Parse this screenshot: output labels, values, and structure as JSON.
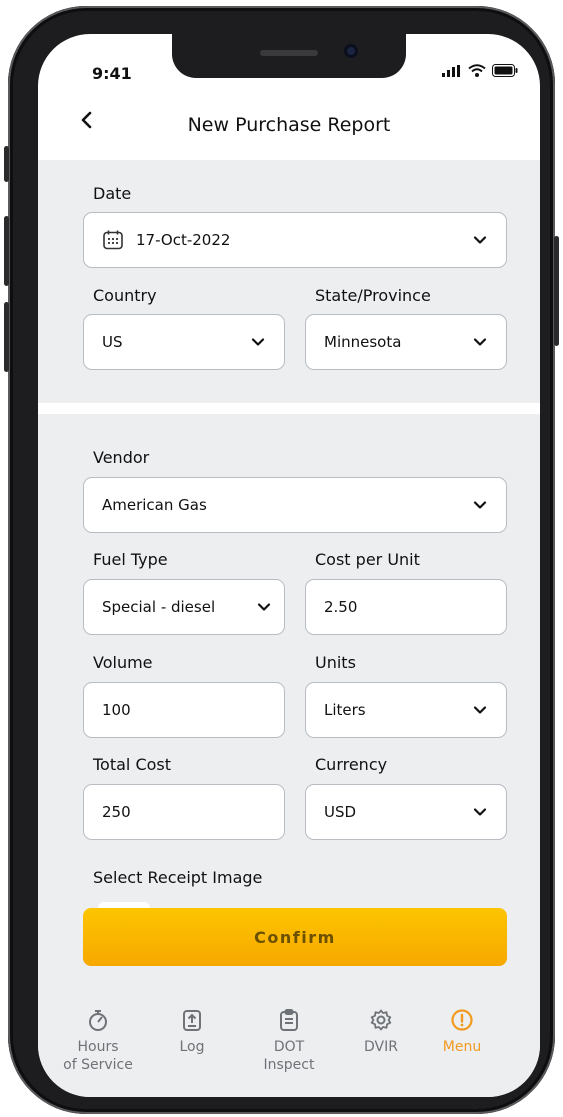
{
  "status": {
    "time": "9:41"
  },
  "header": {
    "back_icon": "chevron-left-icon",
    "title": "New Purchase Report"
  },
  "date": {
    "label": "Date",
    "value": "17-Oct-2022"
  },
  "country": {
    "label": "Country",
    "value": "US"
  },
  "state": {
    "label": "State/Province",
    "value": "Minnesota"
  },
  "vendor": {
    "label": "Vendor",
    "value": "American Gas"
  },
  "fuel_type": {
    "label": "Fuel Type",
    "value": "Special - diesel"
  },
  "cost_per_unit": {
    "label": "Cost per Unit",
    "value": "2.50"
  },
  "volume": {
    "label": "Volume",
    "value": "100"
  },
  "units": {
    "label": "Units",
    "value": "Liters"
  },
  "total_cost": {
    "label": "Total Cost",
    "value": "250"
  },
  "currency": {
    "label": "Currency",
    "value": "USD"
  },
  "receipt": {
    "label": "Select Receipt Image"
  },
  "confirm": {
    "label": "Confirm"
  },
  "tabs": [
    {
      "label": "Hours\nof Service",
      "icon": "stopwatch-icon"
    },
    {
      "label": "Log",
      "icon": "upload-doc-icon"
    },
    {
      "label": "DOT\nInspect",
      "icon": "clipboard-icon"
    },
    {
      "label": "DVIR",
      "icon": "gear-icon"
    },
    {
      "label": "Menu",
      "icon": "info-circle-icon"
    }
  ],
  "colors": {
    "accent": "#f29a1f",
    "button_top": "#fdc500",
    "button_bottom": "#f7a800",
    "section_bg": "#eceef0"
  }
}
